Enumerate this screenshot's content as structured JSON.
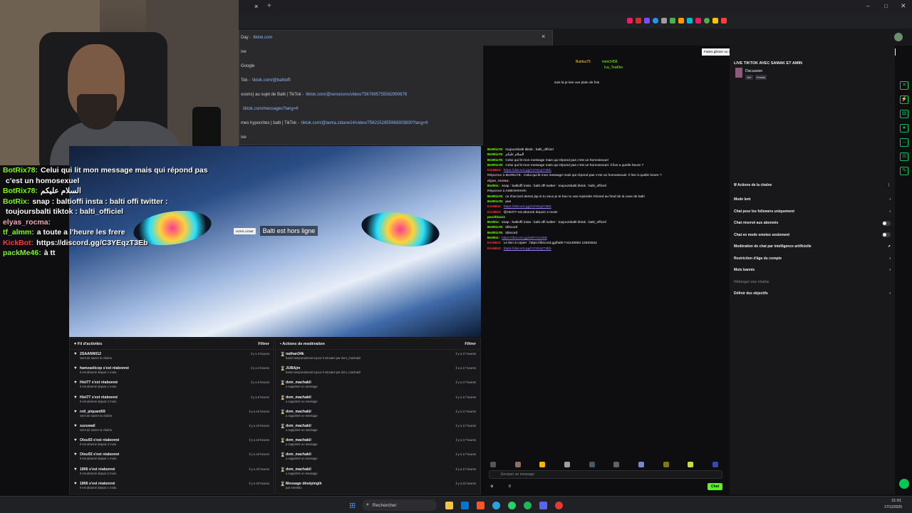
{
  "browser": {
    "tab_close": "×",
    "tab_add": "+"
  },
  "dropdown": {
    "close": "×",
    "rows": [
      {
        "text": "Day -",
        "url": "tiktok.com"
      },
      {
        "text": "ive",
        "url": ""
      },
      {
        "text": "Google",
        "url": ""
      },
      {
        "text": "Tok -",
        "url": "tiktok.com/@baltioffi"
      },
      {
        "text": "ooons) au sujet de Balti | TikTok -",
        "url": "tiktok.com/@xenooons/video/7567695755582950678"
      },
      {
        "text": "",
        "url": "tiktok.com/messages?lang=fr"
      },
      {
        "text": "mes hypocrites | balti | TikTok -",
        "url": "tiktok.com/@lamia.zidane14/video/7562152855969303830?lang=fr"
      },
      {
        "text": "ive",
        "url": ""
      }
    ]
  },
  "overlay_chat": [
    {
      "user": "BotRix78:",
      "color": "#7cfc00",
      "msg": "Celui qui lit mon message mais qui répond pas"
    },
    {
      "user": "",
      "color": "#fff",
      "msg": "c'est un homosexuel"
    },
    {
      "user": "BotRix78:",
      "color": "#7cfc00",
      "msg": "السلام عليكم"
    },
    {
      "user": "BotRix:",
      "color": "#7cfc00",
      "msg": "snap : baltioffi insta : balti offi twitter :"
    },
    {
      "user": "",
      "color": "#fff",
      "msg": "toujoursbalti tiktok : balti_officiel"
    },
    {
      "user": "elyas_rocma:",
      "color": "#f4a6b8",
      "msg": ""
    },
    {
      "user": "tf_almm:",
      "color": "#7cfc00",
      "msg": "a toute a l'heure les frere"
    },
    {
      "user": "KickBot:",
      "color": "#ff3b3b",
      "msg": "https://discord.gg/C3YEqzT3Eb"
    },
    {
      "user": "packMe46:",
      "color": "#7cfc00",
      "msg": "à tt"
    }
  ],
  "video": {
    "badge_tag": "HORS LIGNE",
    "offline_text": "Balti est hors ligne"
  },
  "activity": {
    "title": "Fil d'activités",
    "filter": "Filtrer",
    "items": [
      {
        "name": "2SAANN012",
        "sub": "vient de suivre la chaîne",
        "time": "il y a 3 heures"
      },
      {
        "name": "hamzaelicop s'est réabonné",
        "sub": "Il est abonné depuis 1 mois.",
        "time": "il y a 4 heures"
      },
      {
        "name": "Hiel77 s'est réabonné",
        "sub": "Il est abonné depuis 1 mois.",
        "time": "il y a 6 heures"
      },
      {
        "name": "Hiel77 s'est réabonné",
        "sub": "Il est abonné depuis 3 mois.",
        "time": "il y a 6 heures"
      },
      {
        "name": "roti_piquant69",
        "sub": "vient de suivre la chaîne",
        "time": "il y a 16 heures"
      },
      {
        "name": "suzuwail",
        "sub": "vient de suivre la chaîne",
        "time": "il y a 19 heures"
      },
      {
        "name": "Otsu93 s'est réabonné",
        "sub": "Il est abonné depuis 3 mois.",
        "time": "il y a 19 heures"
      },
      {
        "name": "Otsu93 s'est réabonné",
        "sub": "Il est abonné depuis 1 mois.",
        "time": "il y a 19 heures"
      },
      {
        "name": "1806 s'est réabonné",
        "sub": "Il est abonné depuis 2 mois.",
        "time": "il y a 20 heures"
      },
      {
        "name": "1806 s'est réabonné",
        "sub": "Il est abonné depuis 1 mois.",
        "time": "il y a 20 heures"
      }
    ]
  },
  "moderation": {
    "title": "Actions de modération",
    "filter": "Filtrer",
    "items": [
      {
        "name": "nathan34k",
        "sub": "banni temporairement pour 5 minutes par dvm_machakil",
        "time": "il y a 17 heures"
      },
      {
        "name": "JUBAjm",
        "sub": "banni temporairement pour 5 minutes par dvm_machakil",
        "time": "il y a 17 heures"
      },
      {
        "name": "dvm_machakil",
        "sub": "a supprimé un message",
        "time": "il y a 17 heures"
      },
      {
        "name": "dvm_machakil",
        "sub": "a supprimé un message",
        "time": "il y a 17 heures"
      },
      {
        "name": "dvm_machakil",
        "sub": "a supprimé un message",
        "time": "il y a 17 heures"
      },
      {
        "name": "dvm_machakil",
        "sub": "a supprimé un message",
        "time": "il y a 17 heures"
      },
      {
        "name": "dvm_machakil",
        "sub": "a supprimé un message",
        "time": "il y a 17 heures"
      },
      {
        "name": "dvm_machakil",
        "sub": "a supprimé un message",
        "time": "il y a 17 heures"
      },
      {
        "name": "dvm_machakil",
        "sub": "a supprimé un message",
        "time": "il y a 17 heures"
      },
      {
        "name": "Message désépinglé",
        "sub": "par Anm921",
        "time": "il y a 21 heures"
      }
    ]
  },
  "chat": {
    "top_users": [
      "Buldoz75",
      "mimi3458",
      "Ica_TeaKko"
    ],
    "top_msg": "suis la je lais vue plain de fois",
    "lines": [
      {
        "u": "BotRix78:",
        "c": "#7cfc00",
        "m": "toujoursbalti tiktok : balti_officiel"
      },
      {
        "u": "BotRix78:",
        "c": "#7cfc00",
        "m": "السلام عليكم"
      },
      {
        "u": "BotRix78:",
        "c": "#7cfc00",
        "m": "Celui qui lit mon message mais qui répond pas c'est un homosexuel"
      },
      {
        "u": "BotRix78:",
        "c": "#7cfc00",
        "m": "Celui qui lit mon message mais qui répond pas c'est un homosexuel. Il live a quelle heure ?"
      },
      {
        "u": "KickBot:",
        "c": "#ff3b3b",
        "m": "https://discord.gg/C3YEqzT3Eb",
        "link": true
      },
      {
        "u": "Réponse à BotRix78:",
        "c": "#adadb8",
        "m": "Celui qui lit mon message mais qui répond pas c'est un homosexuel. Il live à quelle heure ?"
      },
      {
        "u": "elyas_rocma:",
        "c": "#f4a6b8",
        "m": ""
      },
      {
        "u": "BotRix:",
        "c": "#7cfc00",
        "m": "snap : baltioffi insta : balti offi twitter : toujoursbalti tiktok : balti_officiel"
      },
      {
        "u": "Réponse à AMESHIVAR:",
        "c": "#adadb8",
        "m": ""
      },
      {
        "u": "BotRix78:",
        "c": "#7cfc00",
        "m": "ce d'accord demoi jsp si tu veux je te bun tu vas rejoindre Ahmed au fond de la cave de balti"
      },
      {
        "u": "BotRix78:",
        "c": "#7cfc00",
        "m": "pas"
      },
      {
        "u": "KickBot:",
        "c": "#ff3b3b",
        "m": "https://discord.gg/C3YEqzT3Eb",
        "link": true
      },
      {
        "u": "KickBot:",
        "c": "#ff3b3b",
        "m": "@Hiel77 est abonné depuis 3 mois!"
      },
      {
        "u": "pas2blazzz",
        "c": "#7cfc00",
        "m": ""
      },
      {
        "u": "BotRix:",
        "c": "#7cfc00",
        "m": "snap : baltioffi insta : balti offi twitter : toujoursbalti tiktok : balti_officiel"
      },
      {
        "u": "BotRix78:",
        "c": "#7cfc00",
        "m": "tdiscord"
      },
      {
        "u": "BotRix78:",
        "c": "#7cfc00",
        "m": "tdiscord"
      },
      {
        "u": "BotRix:",
        "c": "#7cfc00",
        "m": "https://discord.gg/ebRYu2cBB",
        "link": true
      },
      {
        "u": "KickBot:",
        "c": "#ff3b3b",
        "m": "Le lien à copier : https://discord.gg/balti-741140864 12833842"
      },
      {
        "u": "KickBot:",
        "c": "#ff3b3b",
        "m": "https://discord.gg/C3YEqzT3Eb",
        "link": true
      }
    ],
    "input_placeholder": "Envoyer un message",
    "send_label": "Chat",
    "count_label": "0"
  },
  "right_panel": {
    "hint": "Faites glisser ou cliquez sur les widgets ci-dessous pour personnaliser l'affichage de votre tableau de bord",
    "stream_title": "LIVE TIKTOK AVEC SAMAK ET AMIN",
    "category": "Discussion",
    "tags": [
      "18+",
      "French"
    ],
    "channel_actions_title": "Actions de la chaîne",
    "actions": [
      {
        "label": "Mode lent",
        "type": "arrow"
      },
      {
        "label": "Chat pour les followers uniquement",
        "type": "arrow"
      },
      {
        "label": "Chat réservé aux abonnés",
        "type": "toggle"
      },
      {
        "label": "Chat en mode emotes seulement",
        "type": "toggle"
      },
      {
        "label": "Modération de chat par intelligence artificielle",
        "type": "ext"
      },
      {
        "label": "Restriction d'âge du compte",
        "type": "arrow"
      },
      {
        "label": "Mots bannis",
        "type": "arrow"
      },
      {
        "label": "Héberger une chaîne",
        "type": "none"
      },
      {
        "label": "Définir des objectifs",
        "type": "arrow"
      }
    ]
  },
  "taskbar": {
    "search": "Rechercher",
    "time": "21:01",
    "date": "17/12/2025"
  }
}
